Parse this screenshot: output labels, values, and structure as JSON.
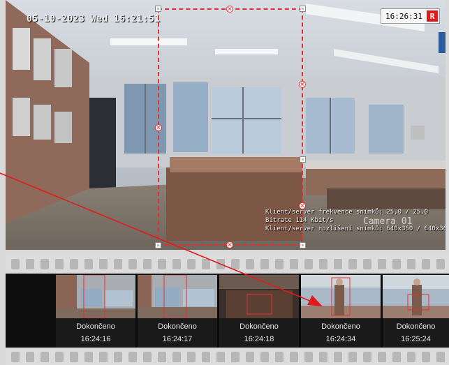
{
  "camera": {
    "osd_datetime": "05-10-2023 Wed 16:21:51",
    "clock": "16:26:31",
    "rec_badge": "R",
    "name": "Camera 01",
    "stats": [
      "Klient/server frekvence snímků: 25,0 / 25,0",
      "Bitrate 114 Kbit/s",
      "Klient/server rozlišení snímků: 640x360 / 640x360"
    ]
  },
  "thumbnails": [
    {
      "status": "Dokončeno",
      "time": "16:24:16"
    },
    {
      "status": "Dokončeno",
      "time": "16:24:17"
    },
    {
      "status": "Dokončeno",
      "time": "16:24:18"
    },
    {
      "status": "Dokončeno",
      "time": "16:24:34"
    },
    {
      "status": "Dokončeno",
      "time": "16:25:24"
    }
  ],
  "colors": {
    "roi": "#e53030",
    "rec_badge": "#e01b1b",
    "annotation_arrow": "#e01b1b"
  }
}
